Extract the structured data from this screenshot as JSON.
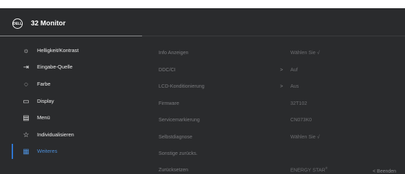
{
  "header": {
    "title": "32 Monitor",
    "logo_text": "DELL"
  },
  "nav": [
    {
      "label": "Helligkeit/Kontrast",
      "icon": "brightness-icon"
    },
    {
      "label": "Eingabe-Quelle",
      "icon": "input-source-icon"
    },
    {
      "label": "Farbe",
      "icon": "color-palette-icon"
    },
    {
      "label": "Display",
      "icon": "display-icon"
    },
    {
      "label": "Menü",
      "icon": "menu-icon"
    },
    {
      "label": "Individualisieren",
      "icon": "star-icon"
    },
    {
      "label": "Weiteres",
      "icon": "others-icon",
      "active": true
    }
  ],
  "rows": [
    {
      "label": "Info Anzeigen",
      "value": "Wählen Sie √",
      "chevron": ""
    },
    {
      "label": "DDC/CI",
      "value": "Auf",
      "chevron": ">"
    },
    {
      "label": "LCD-Konditionierung",
      "value": "Aus",
      "chevron": ">"
    },
    {
      "label": "Firmware",
      "value": "32T102",
      "chevron": ""
    },
    {
      "label": "Servicemarkierung",
      "value": "CN073K0",
      "chevron": ""
    },
    {
      "label": "Selbstdiagnose",
      "value": "Wählen Sie √",
      "chevron": ""
    },
    {
      "label": "Sonstige zurücks.",
      "value": "",
      "chevron": ""
    },
    {
      "label": "Zurücksetzen",
      "value": "ENERGY STAR",
      "value_sup": "®",
      "chevron": ""
    }
  ],
  "footer": {
    "back_label": "<  Beenden"
  },
  "colors": {
    "accent": "#2f78d6",
    "background": "#2a2b2d",
    "active_text": "#4c8ed8"
  }
}
